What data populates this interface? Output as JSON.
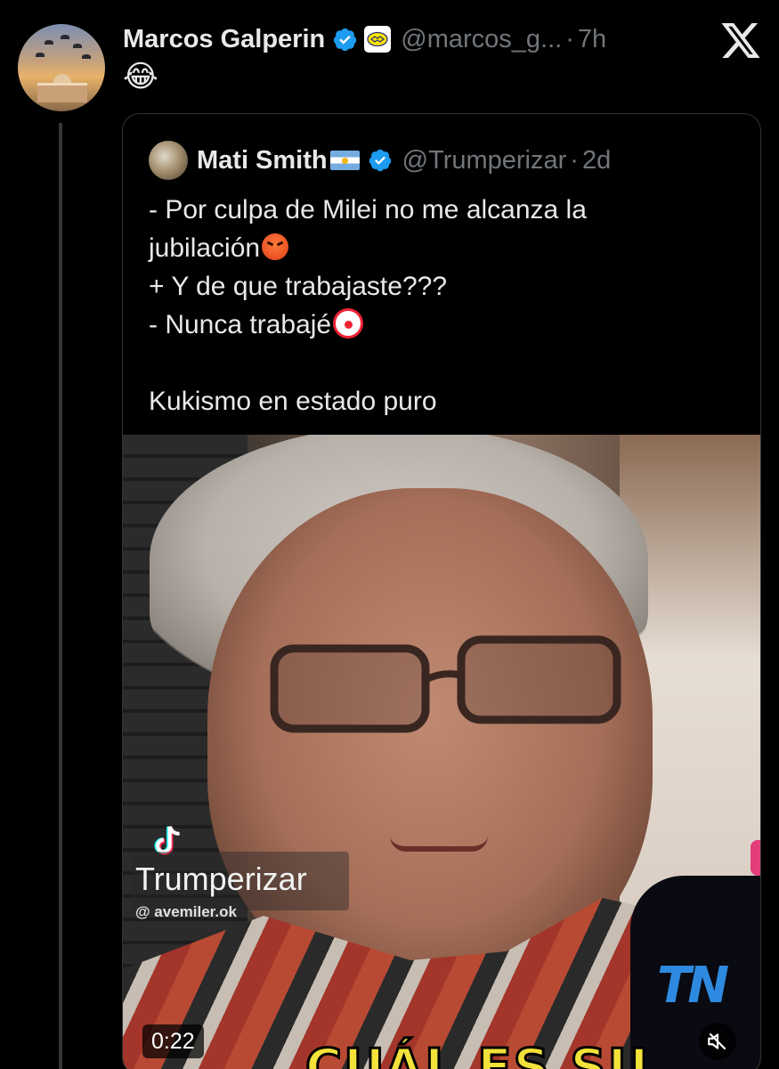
{
  "tweet": {
    "author_name": "Marcos Galperin",
    "handle": "@marcos_g...",
    "separator": "·",
    "time": "7h",
    "text": "😂",
    "icons": [
      "verified-badge-icon",
      "affiliate-badge-icon",
      "x-logo-icon"
    ],
    "colors": {
      "verified": "#1d9bf0",
      "background": "#000000",
      "muted_text": "#71767b"
    }
  },
  "quoted_tweet": {
    "author_name": "Mati Smith",
    "handle": "@Trumperizar",
    "separator": "·",
    "time": "2d",
    "lines": [
      "- Por culpa de Milei no me alcanza la",
      "jubilación",
      "+ Y de que trabajaste???",
      "- Nunca trabajé",
      "",
      "Kukismo en estado puro"
    ]
  },
  "video": {
    "watermark": "Trumperizar",
    "watermark_sub": "@ avemiler.ok",
    "subtitle": "CUÁL ES SU",
    "mic_logo": "TN",
    "duration": "0:22",
    "icons": [
      "tiktok-icon",
      "mute-icon"
    ]
  }
}
